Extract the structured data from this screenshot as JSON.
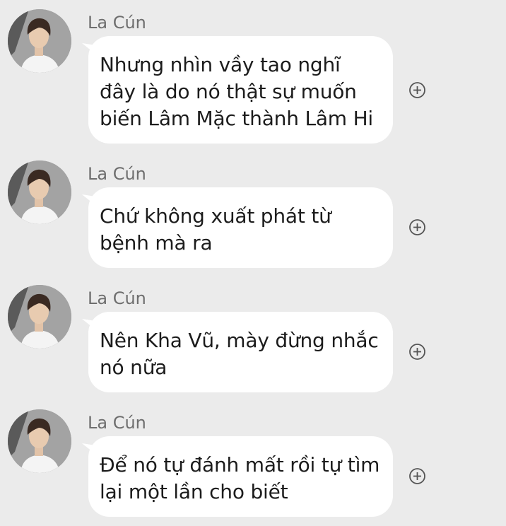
{
  "messages": [
    {
      "sender": "La Cún",
      "text": "Nhưng nhìn vầy tao nghĩ đây là do nó thật sự muốn biến Lâm Mặc thành Lâm Hi"
    },
    {
      "sender": "La Cún",
      "text": "Chứ không xuất phát từ bệnh mà ra"
    },
    {
      "sender": "La Cún",
      "text": "Nên Kha Vũ, mày đừng nhắc nó nữa"
    },
    {
      "sender": "La Cún",
      "text": "Để nó tự đánh mất rồi tự tìm lại một lần cho biết"
    }
  ],
  "icons": {
    "avatar": "avatar-photo",
    "add_reaction": "plus-circle-icon"
  },
  "colors": {
    "background": "#ebebeb",
    "bubble": "#ffffff",
    "sender_text": "#6e6e6e",
    "message_text": "#1c1c1c"
  }
}
